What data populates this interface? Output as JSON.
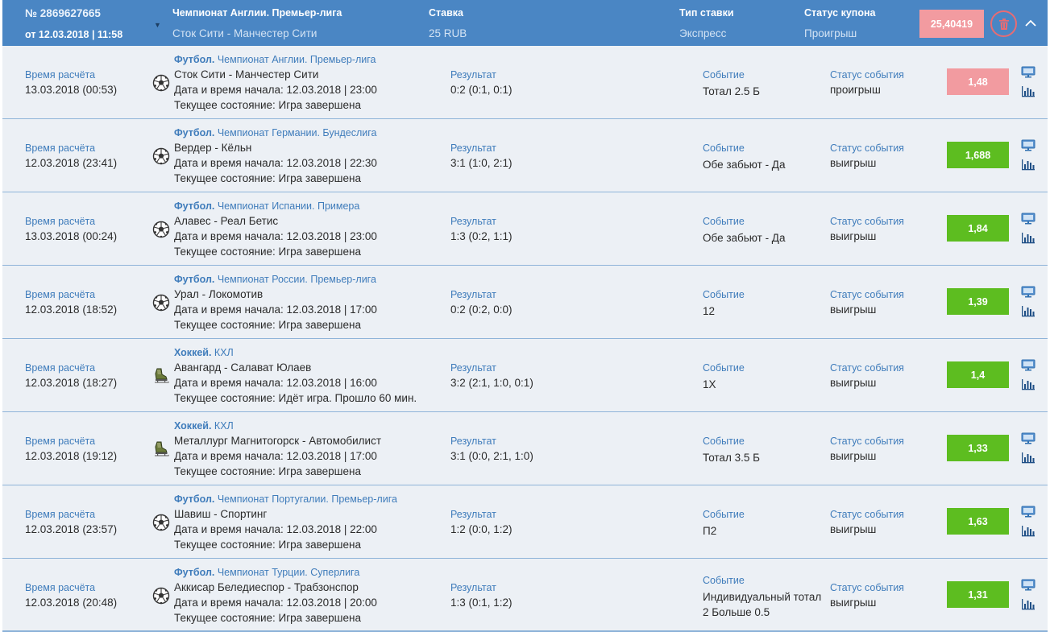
{
  "coupon": {
    "number": "№ 2869627665",
    "date": "от 12.03.2018 | 11:58",
    "championship": "Чемпионат Англии. Премьер-лига",
    "match": "Сток Сити - Манчестер Сити",
    "stake_label": "Ставка",
    "stake_value": "25 RUB",
    "type_label": "Тип ставки",
    "type_value": "Экспресс",
    "status_label": "Статус купона",
    "status_value": "Проигрыш",
    "total_odds": "25,40419"
  },
  "labels": {
    "calc_time": "Время расчёта",
    "result": "Результат",
    "event": "Событие",
    "event_status": "Статус события"
  },
  "colors": {
    "header": "#4a86c4",
    "row_bg": "#ecf0f5",
    "win": "#5dbd20",
    "lose": "#f29ba0",
    "label": "#3f7cbb"
  },
  "events": [
    {
      "calc_time": "13.03.2018 (00:53)",
      "sport": "Футбол.",
      "league": " Чемпионат Англии. Премьер-лига",
      "icon": "soccer-ball-icon",
      "teams": "Сток Сити - Манчестер Сити",
      "start": "Дата и время начала: 12.03.2018 | 23:00",
      "state": "Текущее состояние: Игра завершена",
      "result": "0:2 (0:1, 0:1)",
      "event": "Тотал 2.5 Б",
      "event_status": "проигрыш",
      "odds": "1,48",
      "outcome": "lose"
    },
    {
      "calc_time": "12.03.2018 (23:41)",
      "sport": "Футбол.",
      "league": " Чемпионат Германии. Бундеслига",
      "icon": "soccer-ball-icon",
      "teams": "Вердер - Кёльн",
      "start": "Дата и время начала: 12.03.2018 | 22:30",
      "state": "Текущее состояние: Игра завершена",
      "result": "3:1 (1:0, 2:1)",
      "event": "Обе забьют - Да",
      "event_status": "выигрыш",
      "odds": "1,688",
      "outcome": "win"
    },
    {
      "calc_time": "13.03.2018 (00:24)",
      "sport": "Футбол.",
      "league": " Чемпионат Испании. Примера",
      "icon": "soccer-ball-icon",
      "teams": "Алавес - Реал Бетис",
      "start": "Дата и время начала: 12.03.2018 | 23:00",
      "state": "Текущее состояние: Игра завершена",
      "result": "1:3 (0:2, 1:1)",
      "event": "Обе забьют - Да",
      "event_status": "выигрыш",
      "odds": "1,84",
      "outcome": "win"
    },
    {
      "calc_time": "12.03.2018 (18:52)",
      "sport": "Футбол.",
      "league": " Чемпионат России. Премьер-лига",
      "icon": "soccer-ball-icon",
      "teams": "Урал - Локомотив",
      "start": "Дата и время начала: 12.03.2018 | 17:00",
      "state": "Текущее состояние: Игра завершена",
      "result": "0:2 (0:2, 0:0)",
      "event": "12",
      "event_status": "выигрыш",
      "odds": "1,39",
      "outcome": "win"
    },
    {
      "calc_time": "12.03.2018 (18:27)",
      "sport": "Хоккей.",
      "league": " КХЛ",
      "icon": "hockey-skate-icon",
      "teams": "Авангард - Салават Юлаев",
      "start": "Дата и время начала: 12.03.2018 | 16:00",
      "state": "Текущее состояние: Идёт игра. Прошло 60 мин.",
      "result": "3:2 (2:1, 1:0, 0:1)",
      "event": "1X",
      "event_status": "выигрыш",
      "odds": "1,4",
      "outcome": "win"
    },
    {
      "calc_time": "12.03.2018 (19:12)",
      "sport": "Хоккей.",
      "league": " КХЛ",
      "icon": "hockey-skate-icon",
      "teams": "Металлург Магнитогорск - Автомобилист",
      "start": "Дата и время начала: 12.03.2018 | 17:00",
      "state": "Текущее состояние: Игра завершена",
      "result": "3:1 (0:0, 2:1, 1:0)",
      "event": "Тотал 3.5 Б",
      "event_status": "выигрыш",
      "odds": "1,33",
      "outcome": "win"
    },
    {
      "calc_time": "12.03.2018 (23:57)",
      "sport": "Футбол.",
      "league": " Чемпионат Португалии. Премьер-лига",
      "icon": "soccer-ball-icon",
      "teams": "Шавиш - Спортинг",
      "start": "Дата и время начала: 12.03.2018 | 22:00",
      "state": "Текущее состояние: Игра завершена",
      "result": "1:2 (0:0, 1:2)",
      "event": "П2",
      "event_status": "выигрыш",
      "odds": "1,63",
      "outcome": "win"
    },
    {
      "calc_time": "12.03.2018 (20:48)",
      "sport": "Футбол.",
      "league": " Чемпионат Турции. Суперлига",
      "icon": "soccer-ball-icon",
      "teams": "Аккисар Беледиеспор - Трабзонспор",
      "start": "Дата и время начала: 12.03.2018 | 20:00",
      "state": "Текущее состояние: Игра завершена",
      "result": "1:3 (0:1, 1:2)",
      "event": "Индивидуальный тотал 2 Больше 0.5",
      "event_status": "выигрыш",
      "odds": "1,31",
      "outcome": "win"
    }
  ]
}
